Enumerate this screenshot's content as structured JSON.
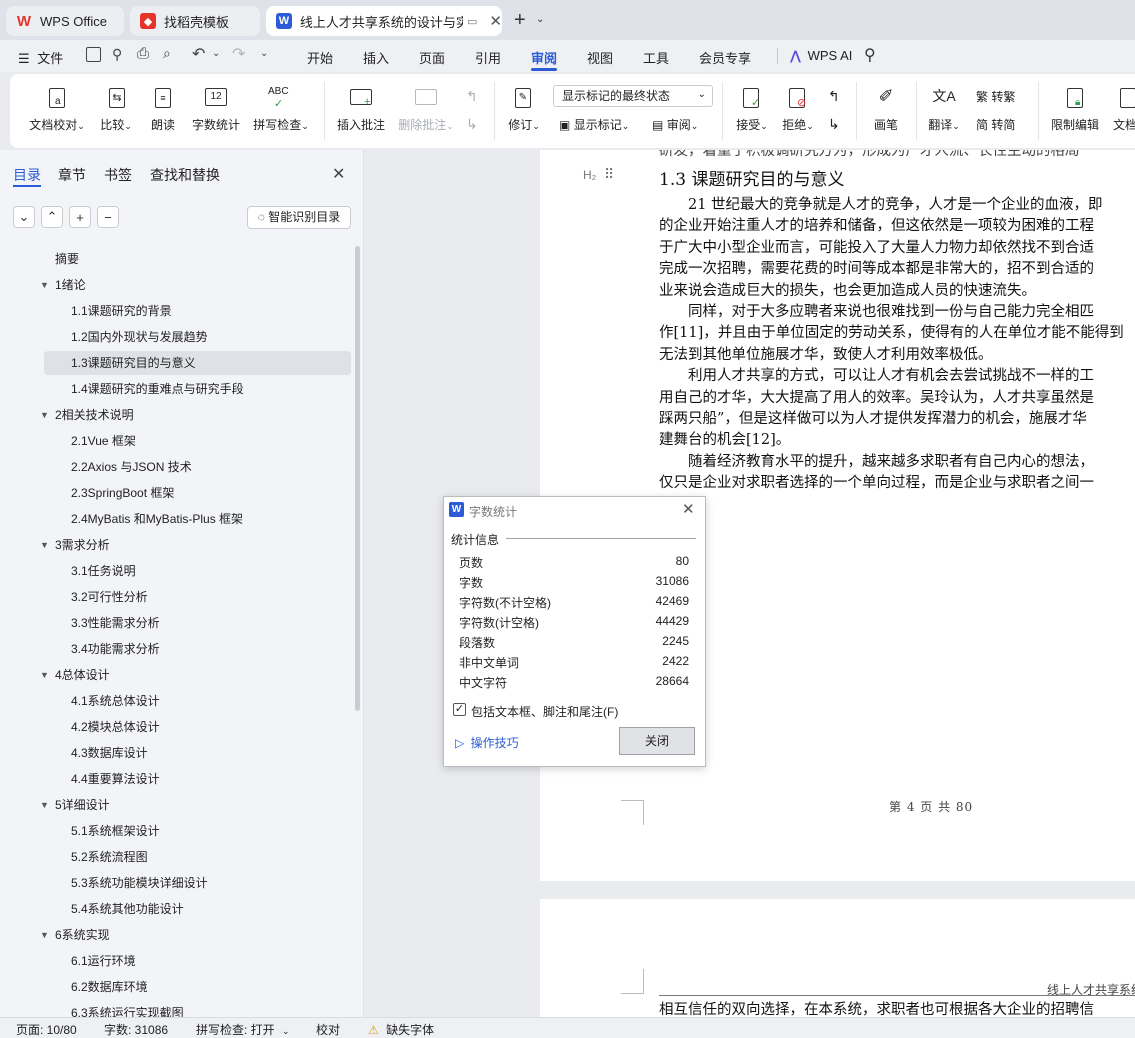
{
  "tabs": [
    {
      "label": "WPS Office"
    },
    {
      "label": "找稻壳模板"
    },
    {
      "label": "线上人才共享系统的设计与实现"
    }
  ],
  "menu": {
    "file": "文件",
    "items": [
      "开始",
      "插入",
      "页面",
      "引用",
      "审阅",
      "视图",
      "工具",
      "会员专享"
    ],
    "active": "审阅",
    "wps_ai": "WPS AI"
  },
  "ribbon": {
    "doc_check": "文档校对",
    "compare": "比较",
    "read_aloud": "朗读",
    "word_count": "字数统计",
    "spell_check": "拼写检查",
    "insert_comment": "插入批注",
    "delete_comment": "删除批注",
    "revise": "修订",
    "markup_select": "显示标记的最终状态",
    "show_markup": "显示标记",
    "review": "审阅",
    "accept": "接受",
    "reject": "拒绝",
    "ink": "画笔",
    "translate": "翻译",
    "to_traditional": "转繁",
    "to_simplified": "转简",
    "restrict_edit": "限制编辑",
    "doc": "文档"
  },
  "panel": {
    "tabs": [
      "目录",
      "章节",
      "书签",
      "查找和替换"
    ],
    "smart_toc": "智能识别目录",
    "toc": [
      "摘要",
      "1绪论",
      "1.1课题研究的背景",
      "1.2国内外现状与发展趋势",
      "1.3课题研究目的与意义",
      "1.4课题研究的重难点与研究手段",
      "2相关技术说明",
      "2.1Vue 框架",
      "2.2Axios 与JSON 技术",
      "2.3SpringBoot 框架",
      "2.4MyBatis 和MyBatis-Plus 框架",
      "3需求分析",
      "3.1任务说明",
      "3.2可行性分析",
      "3.3性能需求分析",
      "3.4功能需求分析",
      "4总体设计",
      "4.1系统总体设计",
      "4.2模块总体设计",
      "4.3数据库设计",
      "4.4重要算法设计",
      "5详细设计",
      "5.1系统框架设计",
      "5.2系统流程图",
      "5.3系统功能模块详细设计",
      "5.4系统其他功能设计",
      "6系统实现",
      "6.1运行环境",
      "6.2数据库环境",
      "6.3系统运行实现截图"
    ]
  },
  "document": {
    "heading_marker": "H₂",
    "heading": "1.3  课题研究目的与意义",
    "top_cut": "研发，着重于积极调研究方为，形成为广才人流、长性主动的格局",
    "lines": [
      "　　21 世纪最大的竞争就是人才的竞争，人才是一个企业的血液，即",
      "的企业开始注重人才的培养和储备，但这依然是一项较为困难的工程",
      "于广大中小型企业而言，可能投入了大量人力物力却依然找不到合适",
      "完成一次招聘，需要花费的时间等成本都是非常大的，招不到合适的",
      "业来说会造成巨大的损失，也会更加造成人员的快速流失。",
      "　　同样，对于大多应聘者来说也很难找到一份与自己能力完全相匹",
      "作[11]，并且由于单位固定的劳动关系，使得有的人在单位才能不能得到",
      "无法到其他单位施展才华，致使人才利用效率极低。",
      "　　利用人才共享的方式，可以让人才有机会去尝试挑战不一样的工",
      "用自己的才华，大大提高了用人的效率。吴玲认为，人才共享虽然是",
      "踩两只船”，但是这样做可以为人才提供发挥潜力的机会，施展才华",
      "建舞台的机会[12]。",
      "　　随着经济教育水平的提升，越来越多求职者有自己内心的想法，",
      "仅只是企业对求职者选择的一个单向过程，而是企业与求职者之间一"
    ],
    "footer": "第 4 页 共 80",
    "page2_header": "线上人才共享系统",
    "page2_line": "相互信任的双向选择，在本系统，求职者也可根据各大企业的招聘信"
  },
  "dialog": {
    "title": "字数统计",
    "section": "统计信息",
    "rows": [
      {
        "label": "页数",
        "value": "80"
      },
      {
        "label": "字数",
        "value": "31086"
      },
      {
        "label": "字符数(不计空格)",
        "value": "42469"
      },
      {
        "label": "字符数(计空格)",
        "value": "44429"
      },
      {
        "label": "段落数",
        "value": "2245"
      },
      {
        "label": "非中文单词",
        "value": "2422"
      },
      {
        "label": "中文字符",
        "value": "28664"
      }
    ],
    "checkbox_label": "包括文本框、脚注和尾注(F)",
    "checkbox_checked": true,
    "tips": "操作技巧",
    "close": "关闭"
  },
  "status": {
    "page": "页面: 10/80",
    "words": "字数: 31086",
    "spell": "拼写检查: 打开",
    "proof": "校对",
    "missing_font": "缺失字体"
  },
  "colors": {
    "accent": "#2b5bd6",
    "wps_red": "#e5352b",
    "selected_toc": "#dfe1e6"
  }
}
